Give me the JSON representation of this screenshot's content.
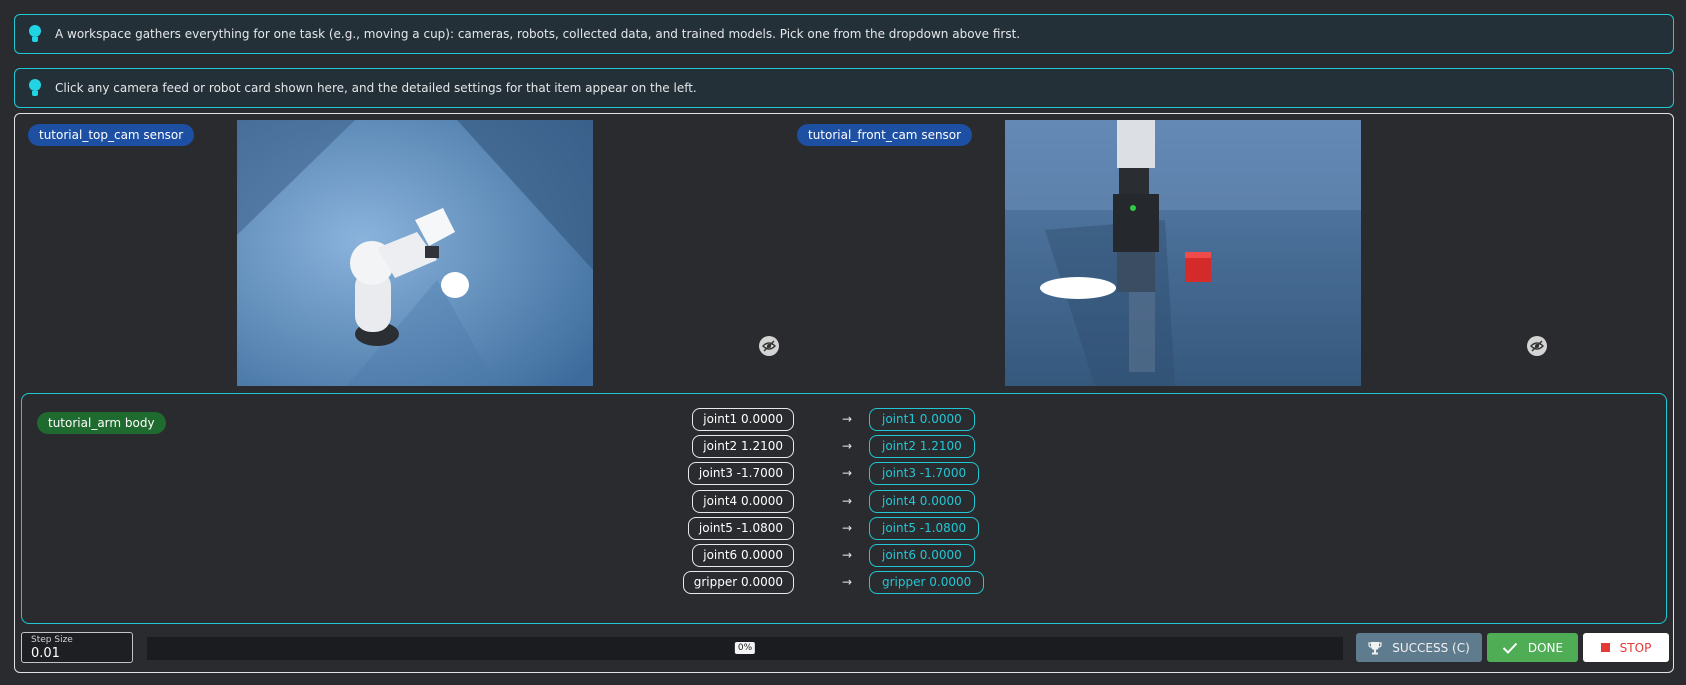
{
  "tips": [
    "A workspace gathers everything for one task (e.g., moving a cup): cameras, robots, collected data, and trained models. Pick one from the dropdown above first.",
    "Click any camera feed or robot card shown here, and the detailed settings for that item appear on the left."
  ],
  "cameras": [
    {
      "label": "tutorial_top_cam sensor"
    },
    {
      "label": "tutorial_front_cam sensor"
    }
  ],
  "robot": {
    "label": "tutorial_arm body",
    "joints": [
      {
        "current": "joint1 0.0000",
        "target": "joint1 0.0000"
      },
      {
        "current": "joint2 1.2100",
        "target": "joint2 1.2100"
      },
      {
        "current": "joint3 -1.7000",
        "target": "joint3 -1.7000"
      },
      {
        "current": "joint4 0.0000",
        "target": "joint4 0.0000"
      },
      {
        "current": "joint5 -1.0800",
        "target": "joint5 -1.0800"
      },
      {
        "current": "joint6 0.0000",
        "target": "joint6 0.0000"
      },
      {
        "current": "gripper 0.0000",
        "target": "gripper 0.0000"
      }
    ],
    "arrow": "→"
  },
  "controls": {
    "step_size_label": "Step Size",
    "step_size_value": "0.01",
    "progress_label": "0%",
    "progress_fraction": 0,
    "success_label": "SUCCESS (C)",
    "done_label": "DONE",
    "stop_label": "STOP"
  },
  "icons": {
    "tip": "lightbulb-icon",
    "camera_hide": "eye-slash-icon",
    "success": "trophy-icon",
    "done": "check-icon",
    "stop": "stop-square-icon"
  },
  "colors": {
    "accent": "#22c7d4",
    "sensor_badge": "#1d4fa3",
    "body_badge": "#1f6a2e",
    "success": "#5f7b8e",
    "done": "#4fad55",
    "stop": "#e53935"
  }
}
